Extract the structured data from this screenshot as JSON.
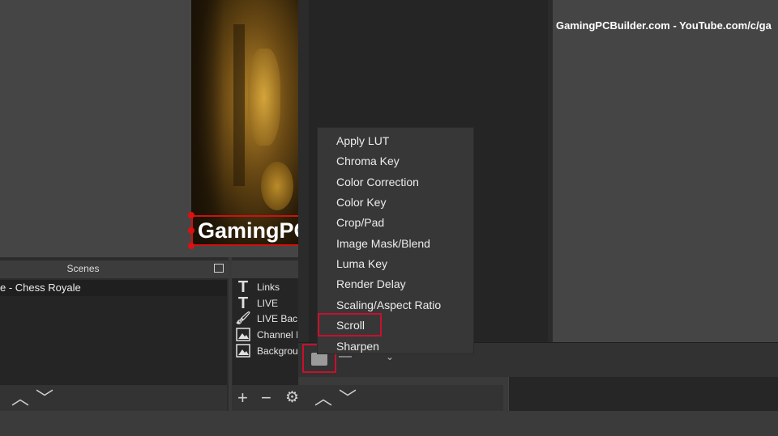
{
  "preview": {
    "overlay_text": "GamingPC"
  },
  "filters_window": {
    "preview_url": "GamingPCBuilder.com - YouTube.com/c/ga",
    "context_menu": {
      "items": [
        "Apply LUT",
        "Chroma Key",
        "Color Correction",
        "Color Key",
        "Crop/Pad",
        "Image Mask/Blend",
        "Luma Key",
        "Render Delay",
        "Scaling/Aspect Ratio",
        "Scroll",
        "Sharpen"
      ],
      "highlighted_item": "Scroll"
    }
  },
  "scenes": {
    "title": "Scenes",
    "selected_scene": "e - Chess Royale"
  },
  "sources": {
    "items": [
      {
        "label": "Links",
        "icon": "text-icon"
      },
      {
        "label": "LIVE",
        "icon": "text-icon"
      },
      {
        "label": "LIVE Back",
        "icon": "brush-icon"
      },
      {
        "label": "Channel I",
        "icon": "image-icon"
      },
      {
        "label": "Backgrou",
        "icon": "image-icon"
      }
    ]
  },
  "colors": {
    "highlight_border": "#c8102e",
    "selection_handle": "#e01010",
    "panel_bg": "#2b2b2b"
  }
}
